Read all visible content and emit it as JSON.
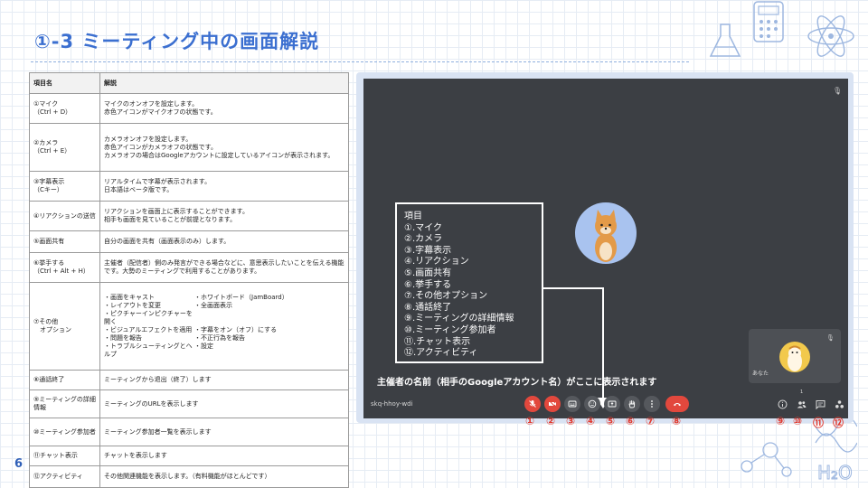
{
  "slide": {
    "title": "①-3 ミーティング中の画面解説",
    "page_number": "6"
  },
  "table": {
    "headers": [
      "項目名",
      "解説"
    ],
    "rows": [
      {
        "name": "①マイク\n（Ctrl + D）",
        "desc": "マイクのオンオフを設定します。\n赤色アイコンがマイクオフの状態です。"
      },
      {
        "name": "②カメラ\n（Ctrl + E）",
        "desc": "カメラオンオフを設定します。\n赤色アイコンがカメラオフの状態です。\nカメラオフの場合はGoogleアカウントに設定しているアイコンが表示されます。"
      },
      {
        "name": "③字幕表示\n（Cキー）",
        "desc": "リアルタイムで字幕が表示されます。\n日本語はベータ版です。"
      },
      {
        "name": "④リアクションの送信",
        "desc": "リアクションを画面上に表示することができます。\n相手も画面を見ていることが前提となります。"
      },
      {
        "name": "⑤画面共有",
        "desc": "自分の画面を共有（画面表示のみ）します。"
      },
      {
        "name": "⑥挙手する\n（Ctrl + Alt + H）",
        "desc": "主催者（配信者）側のみ発言ができる場合などに、意思表示したいことを伝える機能です。大勢のミーティングで利用することがあります。"
      },
      {
        "name": "⑦その他\n　オプション",
        "options": [
          "・画面をキャスト",
          "・ホワイトボード（JamBoard）",
          "・レイアウトを変更",
          "・全画面表示",
          "・ピクチャーインピクチャーを開く",
          "",
          "・ビジュアルエフェクトを適用",
          "・字幕をオン（オフ）にする",
          "・問題を報告",
          "・不正行為を報告",
          "・トラブルシューティングとヘルプ",
          "・設定"
        ]
      },
      {
        "name": "⑧通話終了",
        "desc": "ミーティングから退出（終了）します"
      },
      {
        "name": "⑨ミーティングの詳細情報",
        "desc": "ミーティングのURLを表示します"
      },
      {
        "name": "⑩ミーティング参加者",
        "desc": "ミーティング参加者一覧を表示します"
      },
      {
        "name": "⑪チャット表示",
        "desc": "チャットを表示します"
      },
      {
        "name": "⑫アクティビティ",
        "desc": "その他関連機能を表示します。（有料機能がほとんどです）"
      }
    ]
  },
  "meet": {
    "legend": [
      "項目",
      "①.マイク",
      "②.カメラ",
      "③.字幕表示",
      "④.リアクション",
      "⑤.画面共有",
      "⑥.挙手する",
      "⑦.その他オプション",
      "⑧.通話終了",
      "⑨.ミーティングの詳細情報",
      "⑩.ミーティング参加者",
      "⑪.チャット表示",
      "⑫.アクティビティ"
    ],
    "host_caption": "主催者の名前（相手のGoogleアカウント名）がここに表示されます",
    "self_label": "あなた",
    "meeting_code": "skq-hhoy-wdi",
    "participant_count": "1",
    "numbers": [
      "①",
      "②",
      "③",
      "④",
      "⑤",
      "⑥",
      "⑦",
      "⑧",
      "⑨",
      "⑩",
      "⑪",
      "⑫"
    ],
    "icons": [
      "mic-off-icon",
      "camera-off-icon",
      "captions-icon",
      "emoji-icon",
      "present-icon",
      "hand-icon",
      "more-vert-icon",
      "call-end-icon",
      "info-icon",
      "people-icon",
      "chat-icon",
      "activities-icon"
    ],
    "colors": {
      "screen": "#3c3f44",
      "red": "#e2483d",
      "accent": "#3b6fd0",
      "number": "#e03a2f"
    }
  }
}
